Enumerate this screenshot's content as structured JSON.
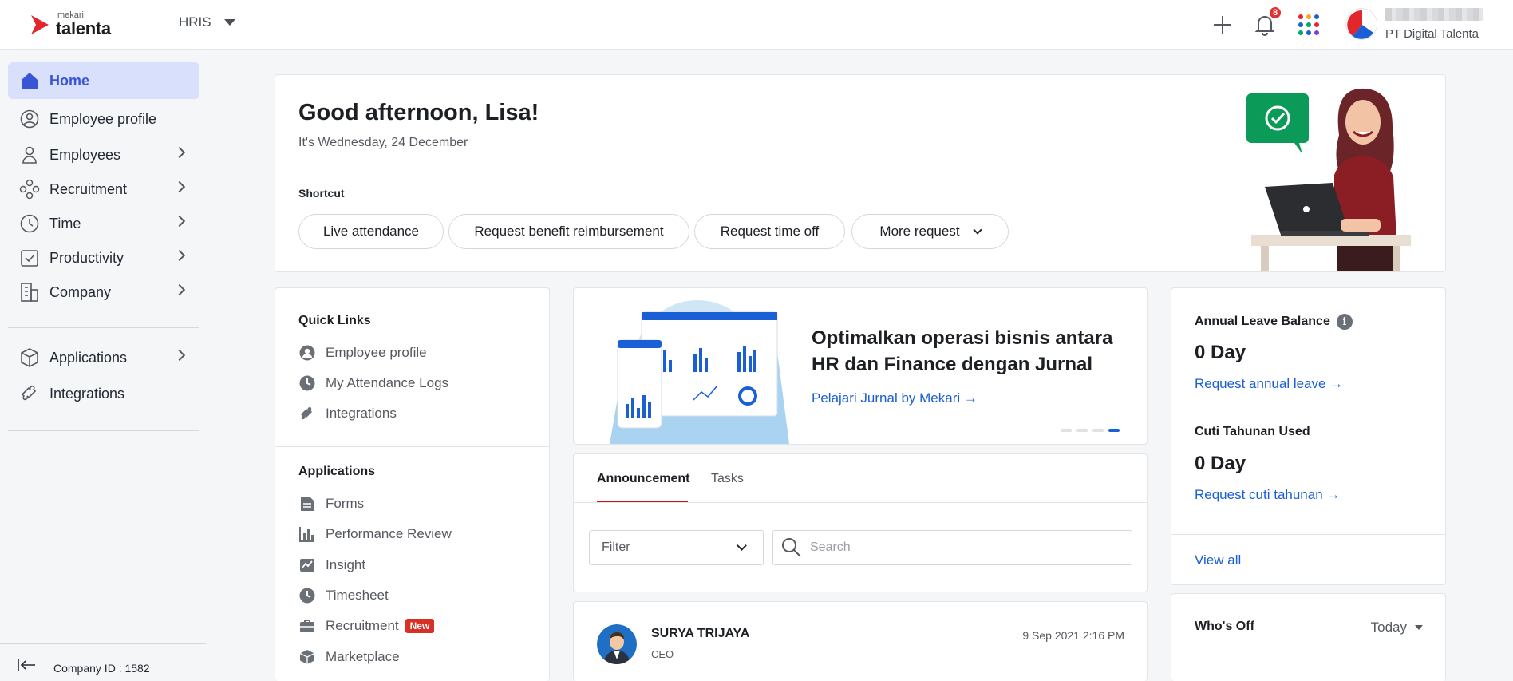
{
  "brand": {
    "sub": "mekari",
    "main": "talenta",
    "accent": "#e3262b"
  },
  "topbar": {
    "module": "HRIS",
    "notification_count": "8",
    "company": "PT Digital Talenta",
    "icons": [
      "plus-icon",
      "bell-icon",
      "apps-grid-icon"
    ]
  },
  "sidebar": {
    "items": [
      {
        "label": "Home",
        "icon": "home-icon",
        "active": true
      },
      {
        "label": "Employee profile",
        "icon": "user-circle-icon"
      },
      {
        "label": "Employees",
        "icon": "person-icon"
      },
      {
        "label": "Recruitment",
        "icon": "people-network-icon"
      },
      {
        "label": "Time",
        "icon": "clock-icon"
      },
      {
        "label": "Productivity",
        "icon": "checklist-icon"
      },
      {
        "label": "Company",
        "icon": "building-icon"
      },
      {
        "label": "Applications",
        "icon": "cube-icon"
      },
      {
        "label": "Integrations",
        "icon": "puzzle-icon"
      }
    ],
    "company_id": "Company ID : 1582"
  },
  "greeting": {
    "title": "Good afternoon, Lisa!",
    "date": "It's Wednesday, 24 December",
    "shortcut_label": "Shortcut",
    "shortcuts": [
      "Live attendance",
      "Request benefit reimbursement",
      "Request time off",
      "More request"
    ]
  },
  "quick_links": {
    "title": "Quick Links",
    "items": [
      "Employee profile",
      "My Attendance Logs",
      "Integrations"
    ],
    "apps_title": "Applications",
    "apps": [
      "Forms",
      "Performance Review",
      "Insight",
      "Timesheet",
      "Recruitment",
      "Marketplace"
    ],
    "new_badge": "New"
  },
  "banner": {
    "title": "Optimalkan operasi bisnis antara HR dan Finance dengan Jurnal",
    "link": "Pelajari Jurnal by Mekari →",
    "slides": 4,
    "active_slide": 4
  },
  "announcement": {
    "tabs": [
      "Announcement",
      "Tasks"
    ],
    "filter": "Filter",
    "search_placeholder": "Search"
  },
  "post": {
    "name": "SURYA TRIJAYA",
    "role": "CEO",
    "time": "9 Sep 2021 2:16 PM"
  },
  "leave": {
    "annual_label": "Annual Leave Balance",
    "annual_value": "0 Day",
    "annual_link": "Request annual leave →",
    "cuti_label": "Cuti Tahunan Used",
    "cuti_value": "0 Day",
    "cuti_link": "Request cuti tahunan →",
    "view_all": "View all"
  },
  "whos_off": {
    "title": "Who's Off",
    "period": "Today"
  }
}
